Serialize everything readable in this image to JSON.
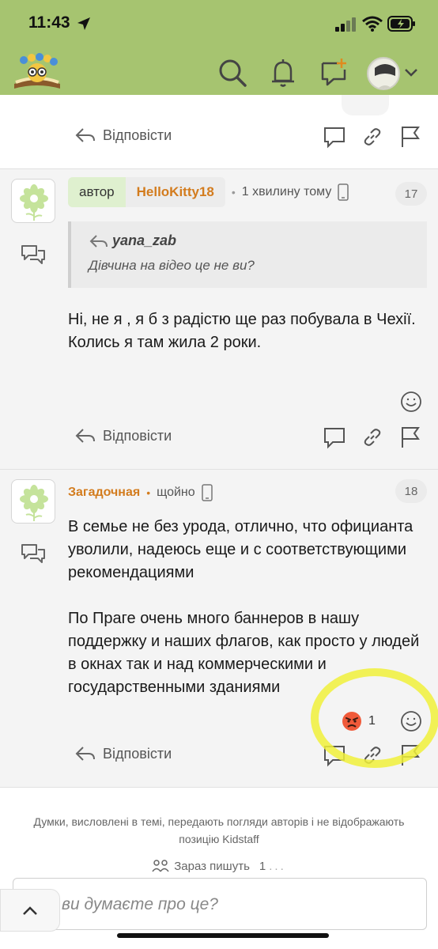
{
  "status_bar": {
    "time": "11:43"
  },
  "header": {
    "logo_alt": "Kidstaff",
    "icons": [
      "search-icon",
      "bell-icon",
      "new-topic-icon",
      "avatar",
      "chevron-down-icon"
    ]
  },
  "top_partial": {
    "reply_label": "Відповісти"
  },
  "posts": [
    {
      "role": "автор",
      "username": "HelloKitty18",
      "time": "1 хвилину тому",
      "number": "17",
      "quote": {
        "author": "yana_zab",
        "text": "Дівчина на відео це не ви?"
      },
      "body": [
        "Ні, не я , я б з радістю ще раз побувала в Чехії.",
        "Колись я там жила 2 роки."
      ],
      "reply_label": "Відповісти"
    },
    {
      "username": "Загадочная",
      "time": "щойно",
      "number": "18",
      "body_p1": "В семье не без урода, отлично, что официанта уволили, надеюсь еще и с соответствующими рекомендациями",
      "body_p2": "По Праге очень много баннеров в нашу поддержку и наших флагов, как просто у людей в окнах так и над коммерческими и государственными зданиями",
      "reaction": {
        "icon": "angry-face-icon",
        "count": "1"
      },
      "reply_label": "Відповісти"
    }
  ],
  "footer": {
    "disclaimer": "Думки, висловлені в темі, передають погляди авторів і не відображають позицію Kidstaff",
    "typing_label": "Зараз пишуть",
    "typing_count": "1",
    "typing_dots": "...",
    "comment_placeholder": "ви думаєте про це?"
  },
  "colors": {
    "header_bg": "#a6c470",
    "username": "#d37c1e",
    "role_badge": "#dff0cf",
    "highlight": "#f0f03a"
  }
}
